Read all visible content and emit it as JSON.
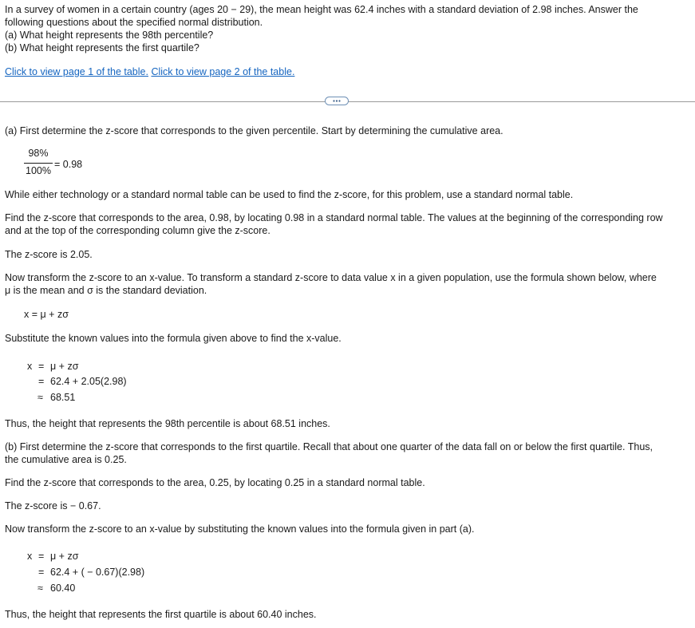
{
  "question": {
    "line1": "In a survey of women in a certain country (ages 20 − 29), the mean height was 62.4 inches with a standard deviation of 2.98 inches. Answer the",
    "line2": "following questions about the specified normal distribution.",
    "part_a": "(a) What height represents the 98th percentile?",
    "part_b": "(b) What height represents the first quartile?"
  },
  "links": {
    "page1": "Click to view page 1 of the table.",
    "page2": "Click to view page 2 of the table."
  },
  "solution": {
    "a_intro": "(a) First determine the z-score that corresponds to the given percentile. Start by determining the cumulative area.",
    "frac_num": "98%",
    "frac_den": "100%",
    "frac_result": "= 0.98",
    "tech_note": "While either technology or a standard normal table can be used to find the z-score, for this problem, use a standard normal table.",
    "find_z_a_line1": "Find the z-score that corresponds to the area, 0.98, by locating 0.98 in a standard normal table. The values at the beginning of the corresponding row",
    "find_z_a_line2": "and at the top of the corresponding column give the z-score.",
    "z_a": "The z-score is 2.05.",
    "transform_line1": "Now transform the z-score to an x-value. To transform a standard z-score to data value x in a given population, use the formula shown below, where",
    "transform_line2": "μ is the mean and σ is the standard deviation.",
    "formula": "x = μ + zσ",
    "substitute": "Substitute the known values into the formula given above to find the x-value.",
    "calc_a": {
      "lhs": "x",
      "eq1": "=",
      "step1": "μ + zσ",
      "eq2": "=",
      "step2": "62.4 + 2.05(2.98)",
      "eq3": "≈",
      "step3": "68.51"
    },
    "conclusion_a": "Thus, the height that represents the 98th percentile is about 68.51 inches.",
    "b_intro_line1": "(b) First determine the z-score that corresponds to the first quartile. Recall that about one quarter of the data fall on or below the first quartile. Thus,",
    "b_intro_line2": "the cumulative area is 0.25.",
    "find_z_b": "Find the z-score that corresponds to the area, 0.25, by locating 0.25 in a standard normal table.",
    "z_b": "The z-score is  − 0.67.",
    "transform_b": "Now transform the z-score to an x-value by substituting the known values into the formula given in part (a).",
    "calc_b": {
      "lhs": "x",
      "eq1": "=",
      "step1": "μ + zσ",
      "eq2": "=",
      "step2": "62.4 + ( − 0.67)(2.98)",
      "eq3": "≈",
      "step3": "60.40"
    },
    "conclusion_b": "Thus, the height that represents the first quartile is about 60.40 inches."
  },
  "colors": {
    "link": "#1565c0",
    "divider": "#9a9a9a",
    "more_button_border": "#6d8fb5"
  },
  "icons": {
    "more_button": "ellipsis-icon"
  }
}
